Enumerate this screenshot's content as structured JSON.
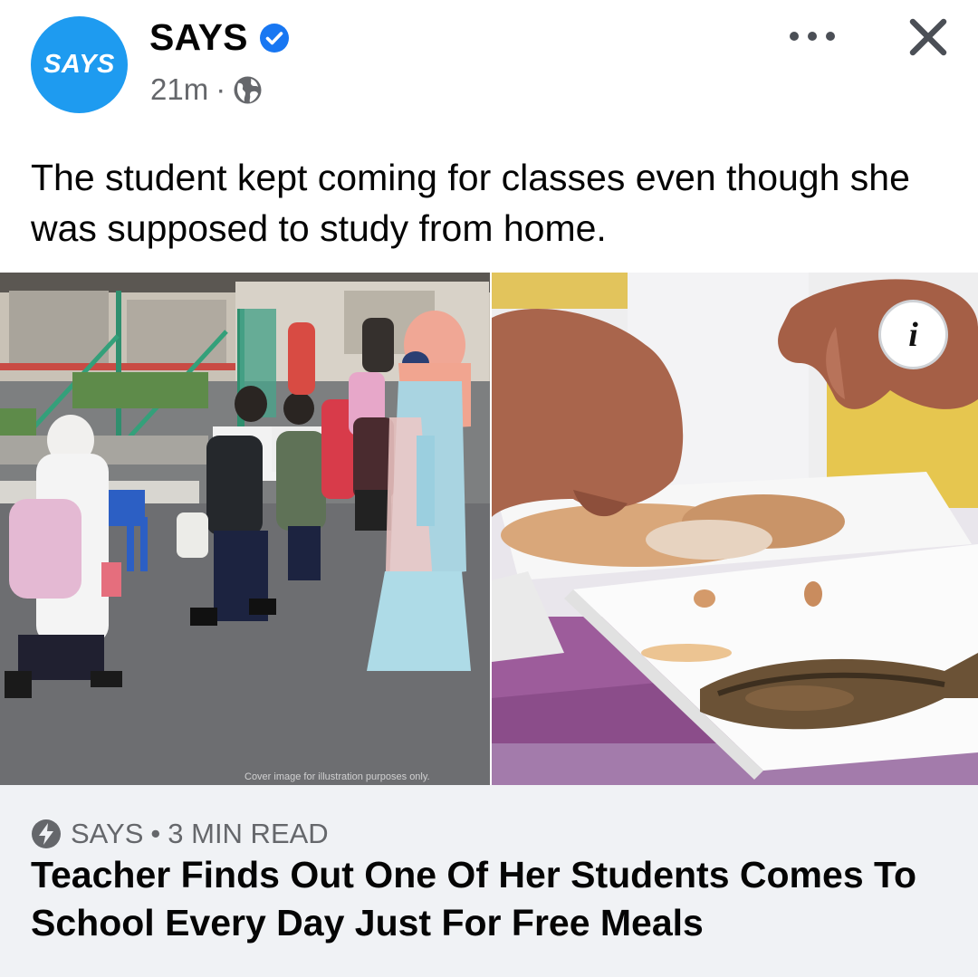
{
  "post": {
    "avatar_text": "SAYS",
    "page_name": "SAYS",
    "time": "21m",
    "separator": "·",
    "caption": "The student kept coming for classes even though she was supposed to study from home.",
    "left_image_credit": "Cover image for illustration purposes only."
  },
  "link_preview": {
    "source": "SAYS",
    "separator": "•",
    "read_time": "3 MIN READ",
    "headline": "Teacher Finds Out One Of Her Students Comes To School Every Day Just For Free Meals"
  },
  "icons": {
    "verified": "verified-badge-icon",
    "privacy": "globe-icon",
    "more": "more-options-icon",
    "close": "close-icon",
    "info": "info-icon",
    "source": "lightning-bolt-icon"
  },
  "colors": {
    "brand_blue": "#1e9bf0",
    "verified_blue": "#1877f2",
    "secondary_text": "#65676b",
    "link_background": "#f0f2f5"
  }
}
